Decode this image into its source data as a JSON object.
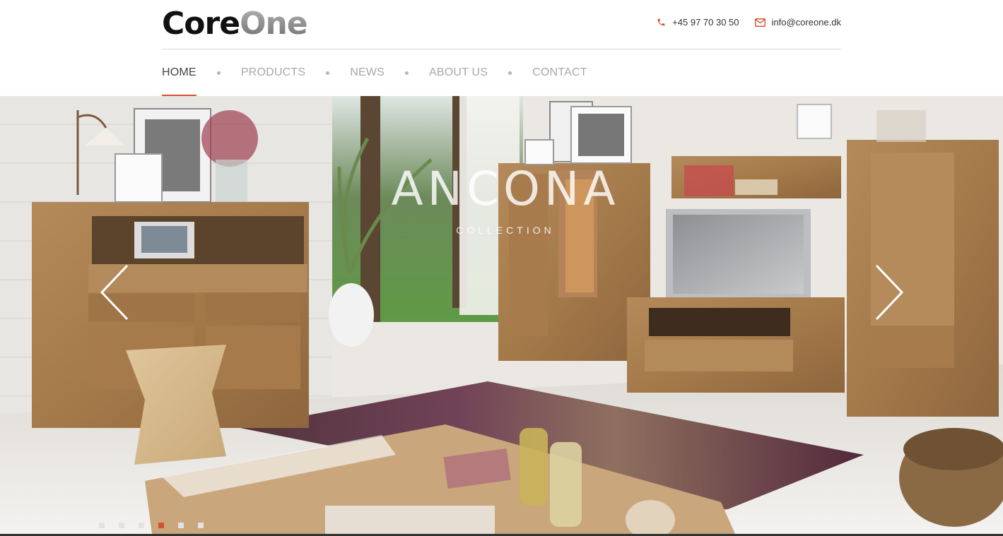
{
  "brand": {
    "logo_part1": "Core",
    "logo_part2": "One"
  },
  "contact": {
    "phone": "+45 97 70 30 50",
    "phone_icon": "phone-icon",
    "email": "info@coreone.dk",
    "email_icon": "envelope-icon",
    "accent_color": "#d2522f"
  },
  "nav": {
    "items": [
      {
        "label": "HOME",
        "active": true
      },
      {
        "label": "PRODUCTS",
        "active": false
      },
      {
        "label": "NEWS",
        "active": false
      },
      {
        "label": "ABOUT US",
        "active": false
      },
      {
        "label": "CONTACT",
        "active": false
      }
    ]
  },
  "slider": {
    "title": "ANCONA",
    "subtitle": "COLLECTION",
    "prev_icon": "chevron-left-icon",
    "next_icon": "chevron-right-icon",
    "slide_count": 6,
    "active_index": 3
  }
}
